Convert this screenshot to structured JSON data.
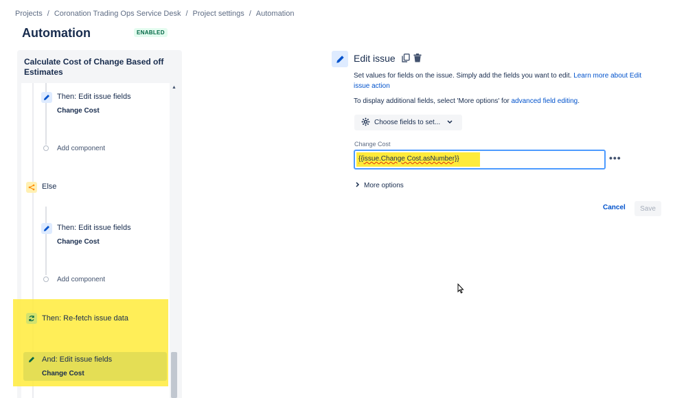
{
  "breadcrumb": {
    "items": [
      "Projects",
      "Coronation Trading Ops Service Desk",
      "Project settings",
      "Automation"
    ],
    "separator": "/"
  },
  "page": {
    "title": "Automation",
    "status_badge": "ENABLED"
  },
  "rule": {
    "title": "Calculate Cost of Change Based off Estimates",
    "components": [
      {
        "label": "Then: Edit issue fields",
        "sub": "Change Cost",
        "icon": "pencil-icon"
      },
      {
        "label": "Add component"
      },
      {
        "label": "Else",
        "icon": "branch-icon"
      },
      {
        "label": "Then: Edit issue fields",
        "sub": "Change Cost",
        "icon": "pencil-icon"
      },
      {
        "label": "Add component"
      },
      {
        "label": "Then: Re-fetch issue data",
        "icon": "refresh-icon"
      },
      {
        "label": "And: Edit issue fields",
        "sub": "Change Cost",
        "icon": "pencil-icon"
      }
    ]
  },
  "edit": {
    "title": "Edit issue",
    "description_text": "Set values for fields on the issue. Simply add the fields you want to edit. ",
    "description_link": "Learn more about Edit issue action",
    "more_text": "To display additional fields, select 'More options' for ",
    "more_link": "advanced field editing",
    "more_end": ".",
    "choose_fields_label": "Choose fields to set...",
    "field_label": "Change Cost",
    "field_value": "{{issue.Change Cost.asNumber}}",
    "more_options_label": "More options",
    "cancel_label": "Cancel",
    "save_label": "Save"
  },
  "colors": {
    "accent": "#0052CC",
    "highlight": "#FFEB3B",
    "badge_green": "#006644"
  }
}
